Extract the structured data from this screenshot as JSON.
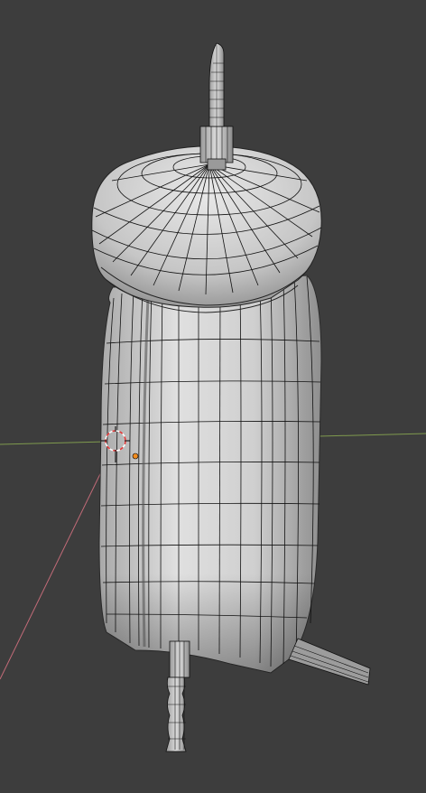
{
  "viewport": {
    "background": "#3d3d3d",
    "mode": "wireframe-on-shaded",
    "object": "alarm-clock-mesh"
  },
  "colors": {
    "x_axis": "#c26b78",
    "y_axis": "#7f9a4e",
    "mesh_fill_light": "#dcdcdc",
    "mesh_fill_dark": "#8c8c8c",
    "wire": "#111111",
    "cursor_ring_a": "#e23636",
    "cursor_ring_b": "#ffffff",
    "object_origin": "#f28c1e"
  },
  "icons": {
    "cursor": "3d-cursor-icon",
    "origin": "object-origin-icon"
  }
}
